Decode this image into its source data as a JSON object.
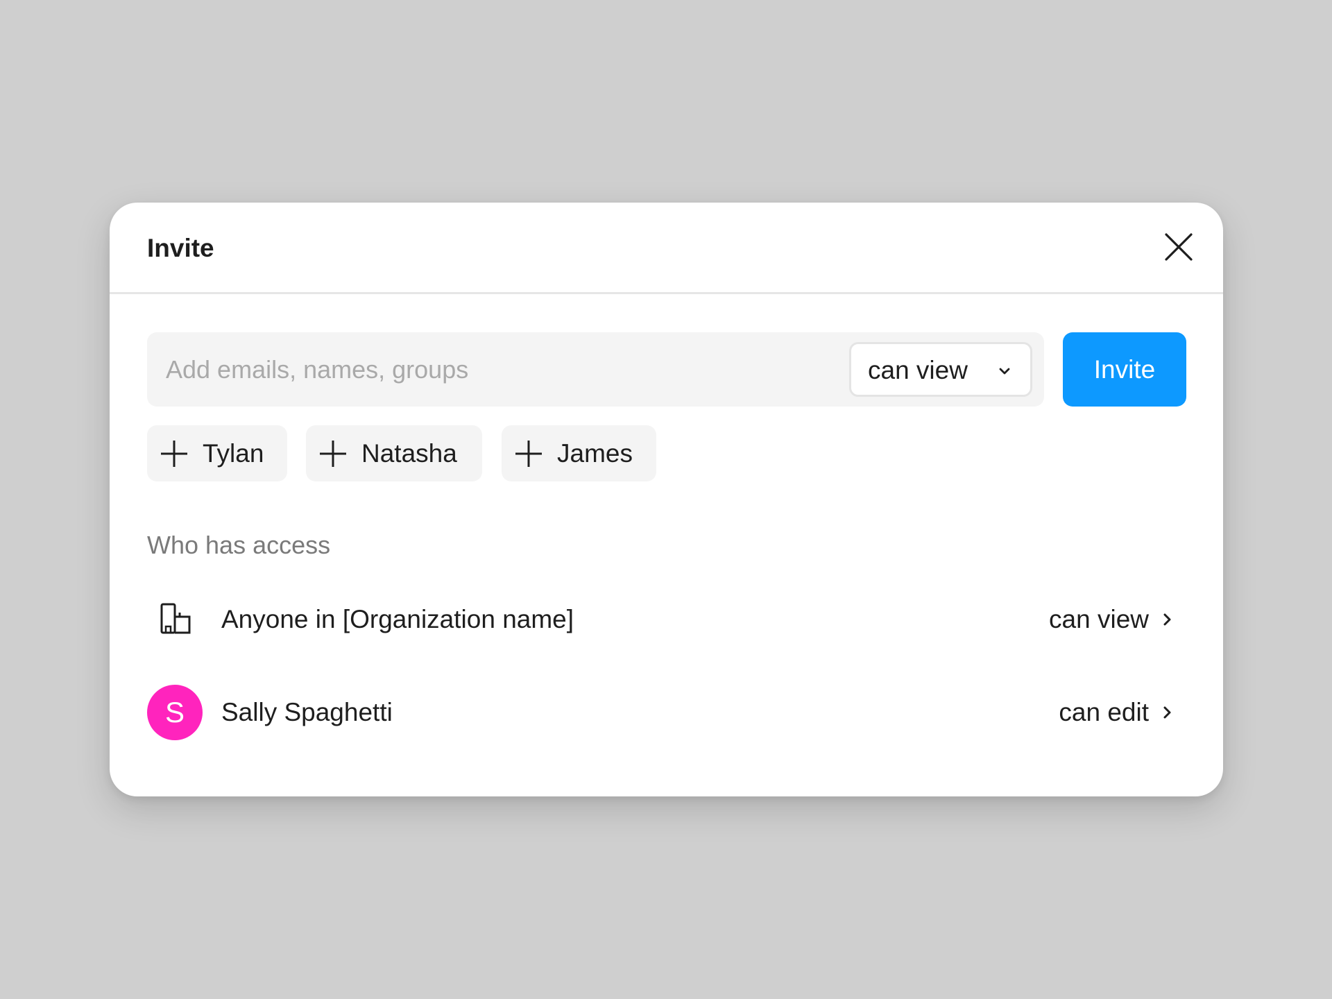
{
  "dialog": {
    "title": "Invite",
    "close_icon": "close-icon"
  },
  "invite": {
    "placeholder": "Add emails, names, groups",
    "value": "",
    "permission": "can view",
    "permission_icon": "chevron-down-icon",
    "button_label": "Invite",
    "button_color": "#0d99ff"
  },
  "suggestions": [
    {
      "icon": "plus-icon",
      "label": "Tylan"
    },
    {
      "icon": "plus-icon",
      "label": "Natasha"
    },
    {
      "icon": "plus-icon",
      "label": "James"
    }
  ],
  "access": {
    "heading": "Who has access",
    "entries": [
      {
        "icon": "organization-icon",
        "name": "Anyone in [Organization name]",
        "permission": "can view",
        "chevron": "chevron-right-icon"
      },
      {
        "avatar_initial": "S",
        "avatar_color": "#ff24bd",
        "name": "Sally Spaghetti",
        "permission": "can edit",
        "chevron": "chevron-right-icon"
      }
    ]
  }
}
